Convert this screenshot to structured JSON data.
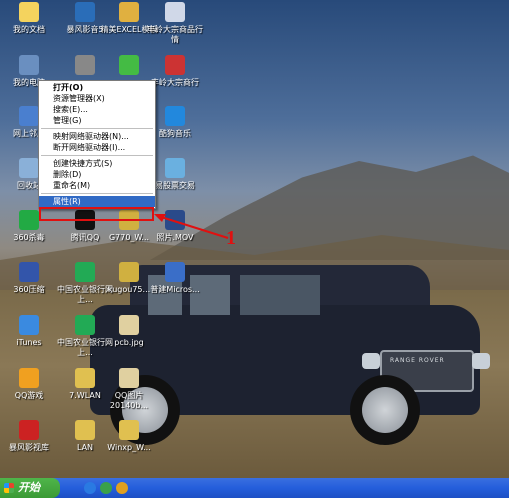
{
  "desktop_icons": [
    {
      "id": "my-documents",
      "label": "我的文档",
      "color": "#f4d35e"
    },
    {
      "id": "baofeng5",
      "label": "暴风影音5",
      "color": "#2a6db8"
    },
    {
      "id": "excel-template",
      "label": "精美EXCEL模板",
      "color": "#e0b040"
    },
    {
      "id": "fengling",
      "label": "丰岭大宗商品行情",
      "color": "#d0d8e8"
    },
    {
      "id": "my-computer",
      "label": "我的电脑",
      "color": "#6a8fc0"
    },
    {
      "id": "icon-row2-b",
      "label": "",
      "color": "#888"
    },
    {
      "id": "icon-row2-c",
      "label": "",
      "color": "#44bb44"
    },
    {
      "id": "fengling2",
      "label": "丰岭大宗商行",
      "color": "#cc3333"
    },
    {
      "id": "network",
      "label": "网上邻居",
      "color": "#4a7fcf"
    },
    {
      "id": "kugou-music",
      "label": "酷狗音乐",
      "color": "#2288dd"
    },
    {
      "id": "recycle-bin",
      "label": "回收站",
      "color": "#8ab0d8"
    },
    {
      "id": "trade-software",
      "label": "易股票交易",
      "color": "#6ab0e0"
    },
    {
      "id": "360-security",
      "label": "360杀毒",
      "color": "#22aa44"
    },
    {
      "id": "tencent-qq",
      "label": "腾讯QQ",
      "color": "#111"
    },
    {
      "id": "g770",
      "label": "G770_W...",
      "color": "#d0b040"
    },
    {
      "id": "photo-mov",
      "label": "照片.MOV",
      "color": "#2a4a8a"
    },
    {
      "id": "360-zip",
      "label": "360压缩",
      "color": "#3355aa"
    },
    {
      "id": "abc-bank",
      "label": "中国农业银行网上...",
      "color": "#22aa55"
    },
    {
      "id": "kugou-file",
      "label": "kugou75...",
      "color": "#d0b040"
    },
    {
      "id": "doc-file",
      "label": "普建Micros...",
      "color": "#3a6ec8"
    },
    {
      "id": "itunes",
      "label": "iTunes",
      "color": "#3a8ae0"
    },
    {
      "id": "china-bank",
      "label": "中国农业银行网上...",
      "color": "#22aa55"
    },
    {
      "id": "pcb-jpg",
      "label": "pcb.jpg",
      "color": "#e0d0a0"
    },
    {
      "id": "qq-game",
      "label": "QQ游戏",
      "color": "#f0a020"
    },
    {
      "id": "wlan",
      "label": "7.WLAN",
      "color": "#e0c050"
    },
    {
      "id": "qq-file",
      "label": "QQ图片20140b...",
      "color": "#e0d0a0"
    },
    {
      "id": "baofeng-vid",
      "label": "暴风影视库",
      "color": "#cc2222"
    },
    {
      "id": "lan",
      "label": "LAN",
      "color": "#e0c050"
    },
    {
      "id": "winxp",
      "label": "Winxp_W...",
      "color": "#e0c050"
    }
  ],
  "context_menu": {
    "items": [
      {
        "label": "打开(O)",
        "bold": true
      },
      {
        "label": "资源管理器(X)"
      },
      {
        "label": "搜索(E)..."
      },
      {
        "label": "管理(G)"
      },
      {
        "sep": true
      },
      {
        "label": "映射网络驱动器(N)..."
      },
      {
        "label": "断开网络驱动器(I)..."
      },
      {
        "sep": true
      },
      {
        "label": "创建快捷方式(S)"
      },
      {
        "label": "删除(D)"
      },
      {
        "label": "重命名(M)"
      },
      {
        "sep": true
      },
      {
        "label": "属性(R)",
        "highlight": true
      }
    ]
  },
  "annotation": {
    "number": "1",
    "color": "#e01010"
  },
  "car": {
    "grille_text": "RANGE ROVER"
  },
  "taskbar": {
    "start_label": "开始"
  }
}
